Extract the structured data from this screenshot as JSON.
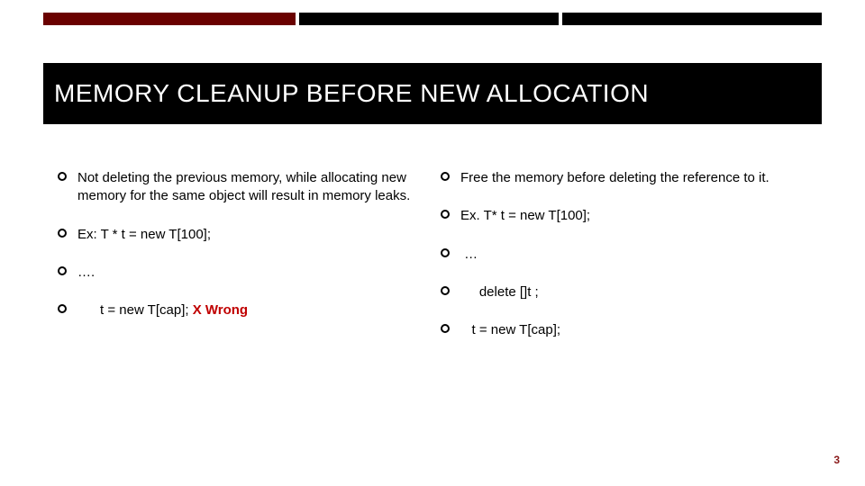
{
  "title": "MEMORY CLEANUP BEFORE NEW ALLOCATION",
  "left_column": {
    "items": [
      "Not deleting the previous memory, while allocating new memory for the same object will result in memory leaks.",
      "Ex: T * t = new T[100];",
      "….",
      {
        "prefix": "      t = new T[cap]; ",
        "wrong": "X Wrong"
      }
    ]
  },
  "right_column": {
    "items": [
      "Free the memory before  deleting the reference to  it.",
      "Ex. T* t = new T[100];",
      " …",
      "     delete []t ;",
      "   t = new T[cap];"
    ]
  },
  "slide_number": "3",
  "chart_data": null
}
